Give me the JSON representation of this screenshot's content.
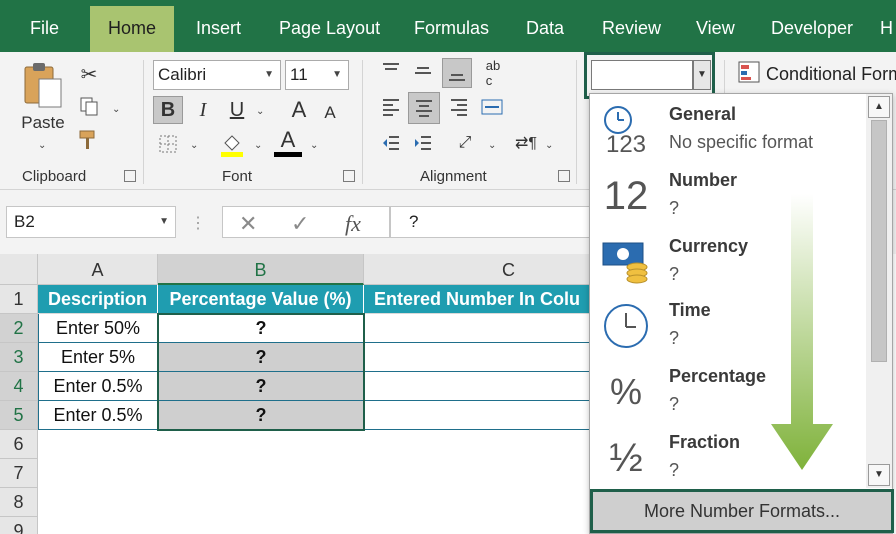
{
  "tabs": [
    "File",
    "Home",
    "Insert",
    "Page Layout",
    "Formulas",
    "Data",
    "Review",
    "View",
    "Developer",
    "H"
  ],
  "ribbon": {
    "clipboard": {
      "paste_label": "Paste",
      "group_label": "Clipboard"
    },
    "font": {
      "font_name": "Calibri",
      "font_size": "11",
      "bold": "B",
      "italic": "I",
      "underline": "U",
      "grow": "A",
      "shrink": "A",
      "font_color": "A",
      "group_label": "Font"
    },
    "alignment": {
      "group_label": "Alignment"
    },
    "number": {
      "format_value": ""
    },
    "styles": {
      "conditional_label": "Conditional Form"
    }
  },
  "formula_bar": {
    "name_box": "B2",
    "cancel": "✕",
    "enter": "✓",
    "fx": "fx",
    "formula": "?"
  },
  "grid": {
    "columns": [
      "A",
      "B",
      "C"
    ],
    "rows": [
      "1",
      "2",
      "3",
      "4",
      "5",
      "6",
      "7",
      "8",
      "9"
    ],
    "headers": [
      "Description",
      "Percentage Value (%)",
      "Entered Number In Colu"
    ],
    "data": [
      [
        "Enter 50%",
        "?"
      ],
      [
        "Enter 5%",
        "?"
      ],
      [
        "Enter 0.5%",
        "?"
      ],
      [
        "Enter 0.5%",
        "?"
      ]
    ]
  },
  "number_format_menu": {
    "items": [
      {
        "name": "General",
        "sample": "No specific format",
        "icon": "general-123-icon",
        "icon_text": "123"
      },
      {
        "name": "Number",
        "sample": "?",
        "icon": "number-12-icon",
        "icon_text": "12"
      },
      {
        "name": "Currency",
        "sample": "?",
        "icon": "currency-icon"
      },
      {
        "name": "Time",
        "sample": "?",
        "icon": "clock-icon"
      },
      {
        "name": "Percentage",
        "sample": "?",
        "icon": "percent-icon",
        "icon_text": "%"
      },
      {
        "name": "Fraction",
        "sample": "?",
        "icon": "fraction-icon",
        "icon_text": "½"
      }
    ],
    "more_label": "More Number Formats...",
    "arrow_color": "#7fb23a"
  },
  "colors": {
    "tabbar": "#217346",
    "active_tab": "#a9c470",
    "table_header": "#1f9db0",
    "selection": "#1f5f4a"
  }
}
